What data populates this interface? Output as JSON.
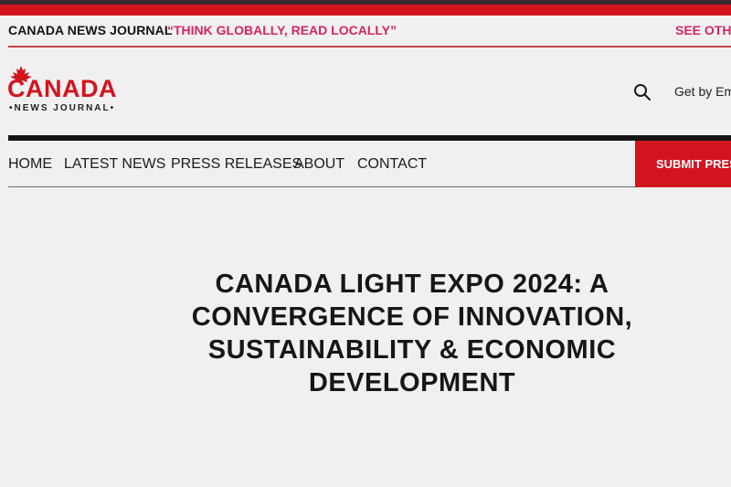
{
  "topbar": {
    "brand": "CANADA NEWS JOURNAL",
    "slogan": "“THINK GLOBALLY, READ LOCALLY”",
    "see_other": "SEE OTHE"
  },
  "logo": {
    "word": "CANADA",
    "subtitle": "•NEWS JOURNAL•"
  },
  "header": {
    "email_cta": "Get by Ema"
  },
  "nav": {
    "items": [
      {
        "label": "HOME"
      },
      {
        "label": "LATEST NEWS"
      },
      {
        "label": "PRESS RELEASES"
      },
      {
        "label": "ABOUT"
      },
      {
        "label": "CONTACT"
      }
    ],
    "submit_label": "SUBMIT PRES"
  },
  "article": {
    "headline": "CANADA LIGHT EXPO 2024: A CONVERGENCE OF INNOVATION, SUSTAINABILITY & ECONOMIC DEVELOPMENT"
  },
  "colors": {
    "brand_red": "#d3141f",
    "slogan_pink": "#d42665",
    "background": "#f1f0f0"
  },
  "icons": [
    "maple-leaf-icon",
    "search-icon"
  ]
}
